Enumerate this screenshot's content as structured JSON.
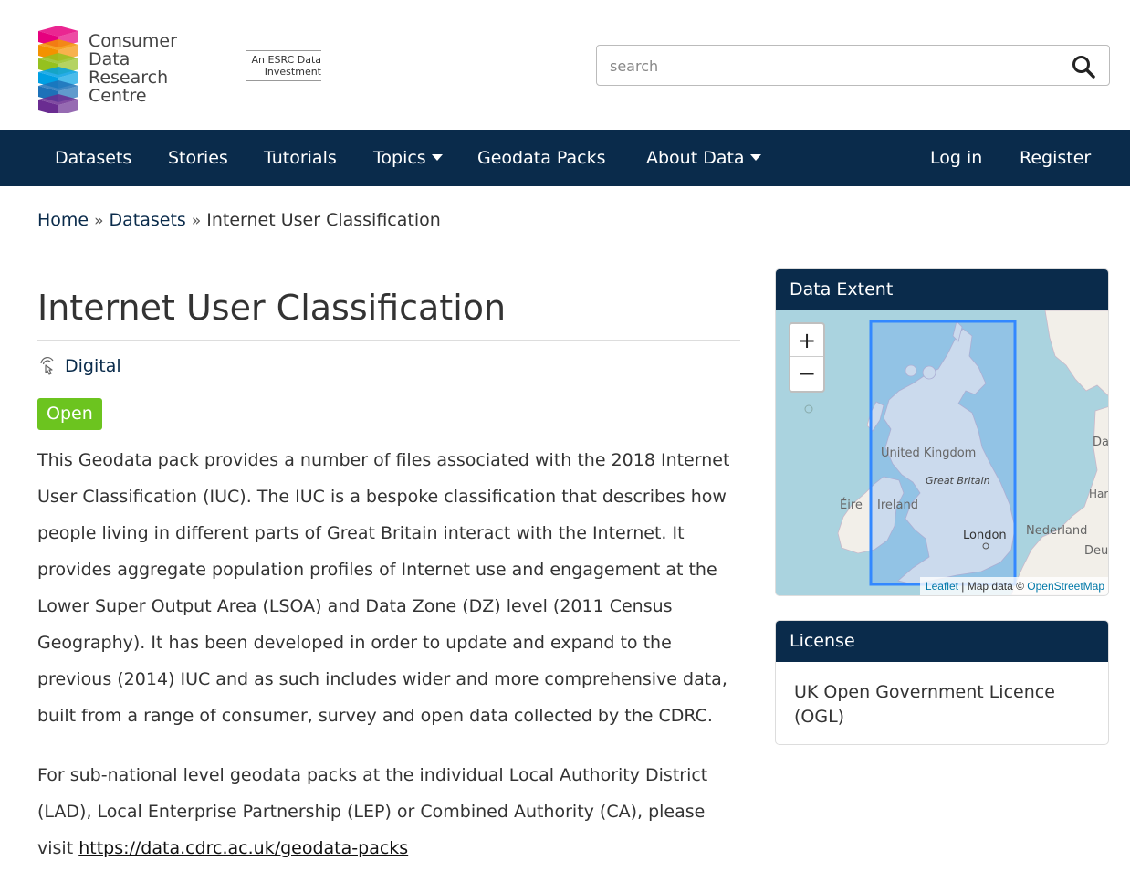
{
  "header": {
    "logo_lines": [
      "Consumer",
      "Data",
      "Research",
      "Centre"
    ],
    "esrc_line1": "An ESRC Data",
    "esrc_line2": "Investment",
    "search_placeholder": "search",
    "logo_colors": [
      "#e6007e",
      "#f39200",
      "#95c11f",
      "#009fe3",
      "#1d71b8",
      "#6a2c91"
    ]
  },
  "nav": {
    "left": [
      {
        "label": "Datasets",
        "dropdown": false
      },
      {
        "label": "Stories",
        "dropdown": false
      },
      {
        "label": "Tutorials",
        "dropdown": false
      },
      {
        "label": "Topics",
        "dropdown": true
      },
      {
        "label": "Geodata Packs",
        "dropdown": false
      },
      {
        "label": "About Data",
        "dropdown": true
      }
    ],
    "right": [
      {
        "label": "Log in"
      },
      {
        "label": "Register"
      }
    ],
    "background": "#0a2b4b"
  },
  "breadcrumb": {
    "home": "Home",
    "sep": "»",
    "datasets": "Datasets",
    "current": "Internet User Classification"
  },
  "dataset": {
    "title": "Internet User Classification",
    "topic": "Digital",
    "badge": "Open",
    "badge_color": "#6cc41f",
    "paragraph1": "This Geodata pack provides a number of files associated with the 2018 Internet User Classification (IUC). The IUC is a bespoke classification that describes how people living in different parts of Great Britain interact with the Internet. It provides aggregate population profiles of Internet use and engagement at the Lower Super Output Area (LSOA) and Data Zone (DZ) level (2011 Census Geography). It has been developed in order to update and expand to the previous (2014) IUC and as such includes wider and more comprehensive data, built from a range of consumer, survey and open data collected by the CDRC.",
    "paragraph2_text": "For sub-national level geodata packs at the individual Local Authority District (LAD), Local Enterprise Partnership (LEP) or Combined Authority (CA), please visit ",
    "paragraph2_link": "https://data.cdrc.ac.uk/geodata-packs"
  },
  "data_extent": {
    "heading": "Data Extent",
    "zoom_in": "+",
    "zoom_out": "−",
    "map_labels": {
      "uk": "United Kingdom",
      "gb": "Great Britain",
      "eire": "Éire",
      "ireland": "Ireland",
      "london": "London",
      "nederland": "Nederland",
      "dan": "Dan",
      "har": "Har",
      "deu": "Deu"
    },
    "attribution_leaflet": "Leaflet",
    "attribution_mid": " | Map data © ",
    "attribution_osm": "OpenStreetMap"
  },
  "license": {
    "heading": "License",
    "value": "UK Open Government Licence (OGL)"
  }
}
